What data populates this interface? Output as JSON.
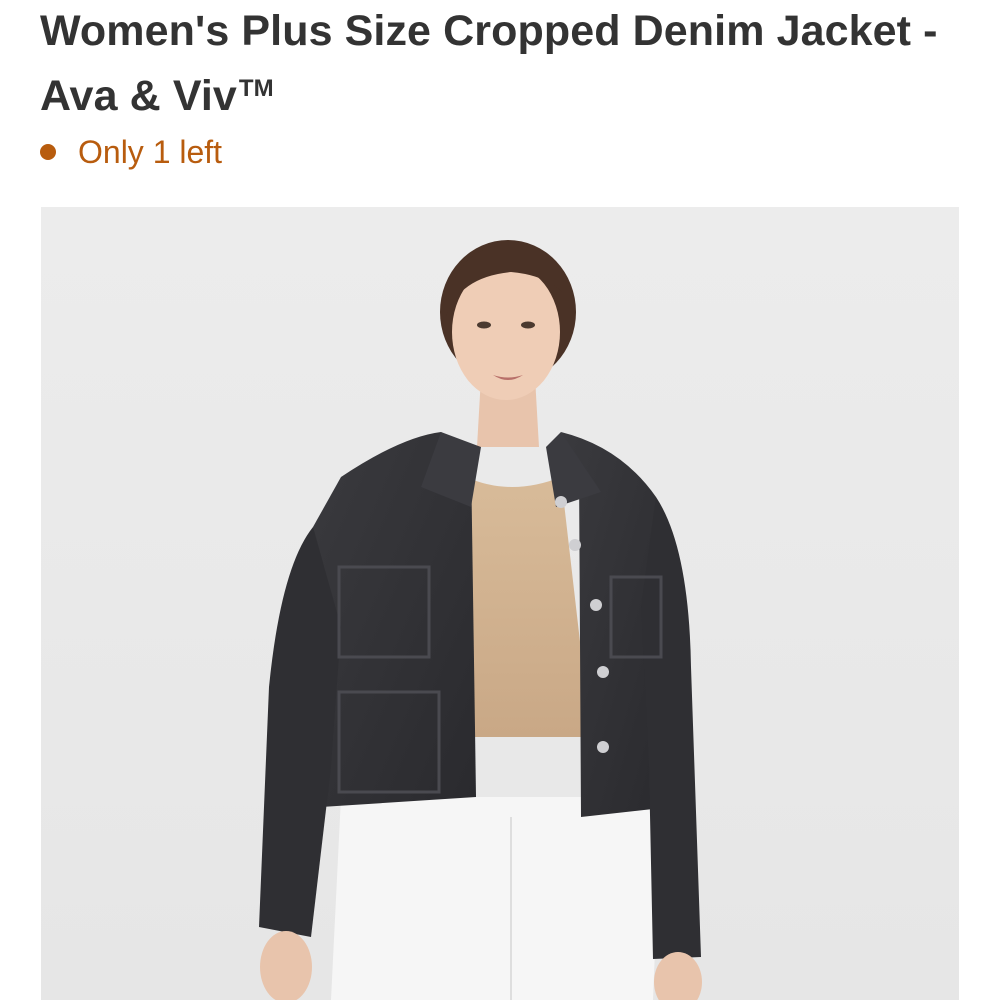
{
  "product": {
    "title": "Women's Plus Size Cropped Denim Jacket - Ava & Viv",
    "trademark": "TM"
  },
  "stock": {
    "text": "Only 1 left",
    "color": "#b85c0e"
  },
  "image": {
    "description_icon": "product-photo",
    "background": "#ebebeb"
  }
}
